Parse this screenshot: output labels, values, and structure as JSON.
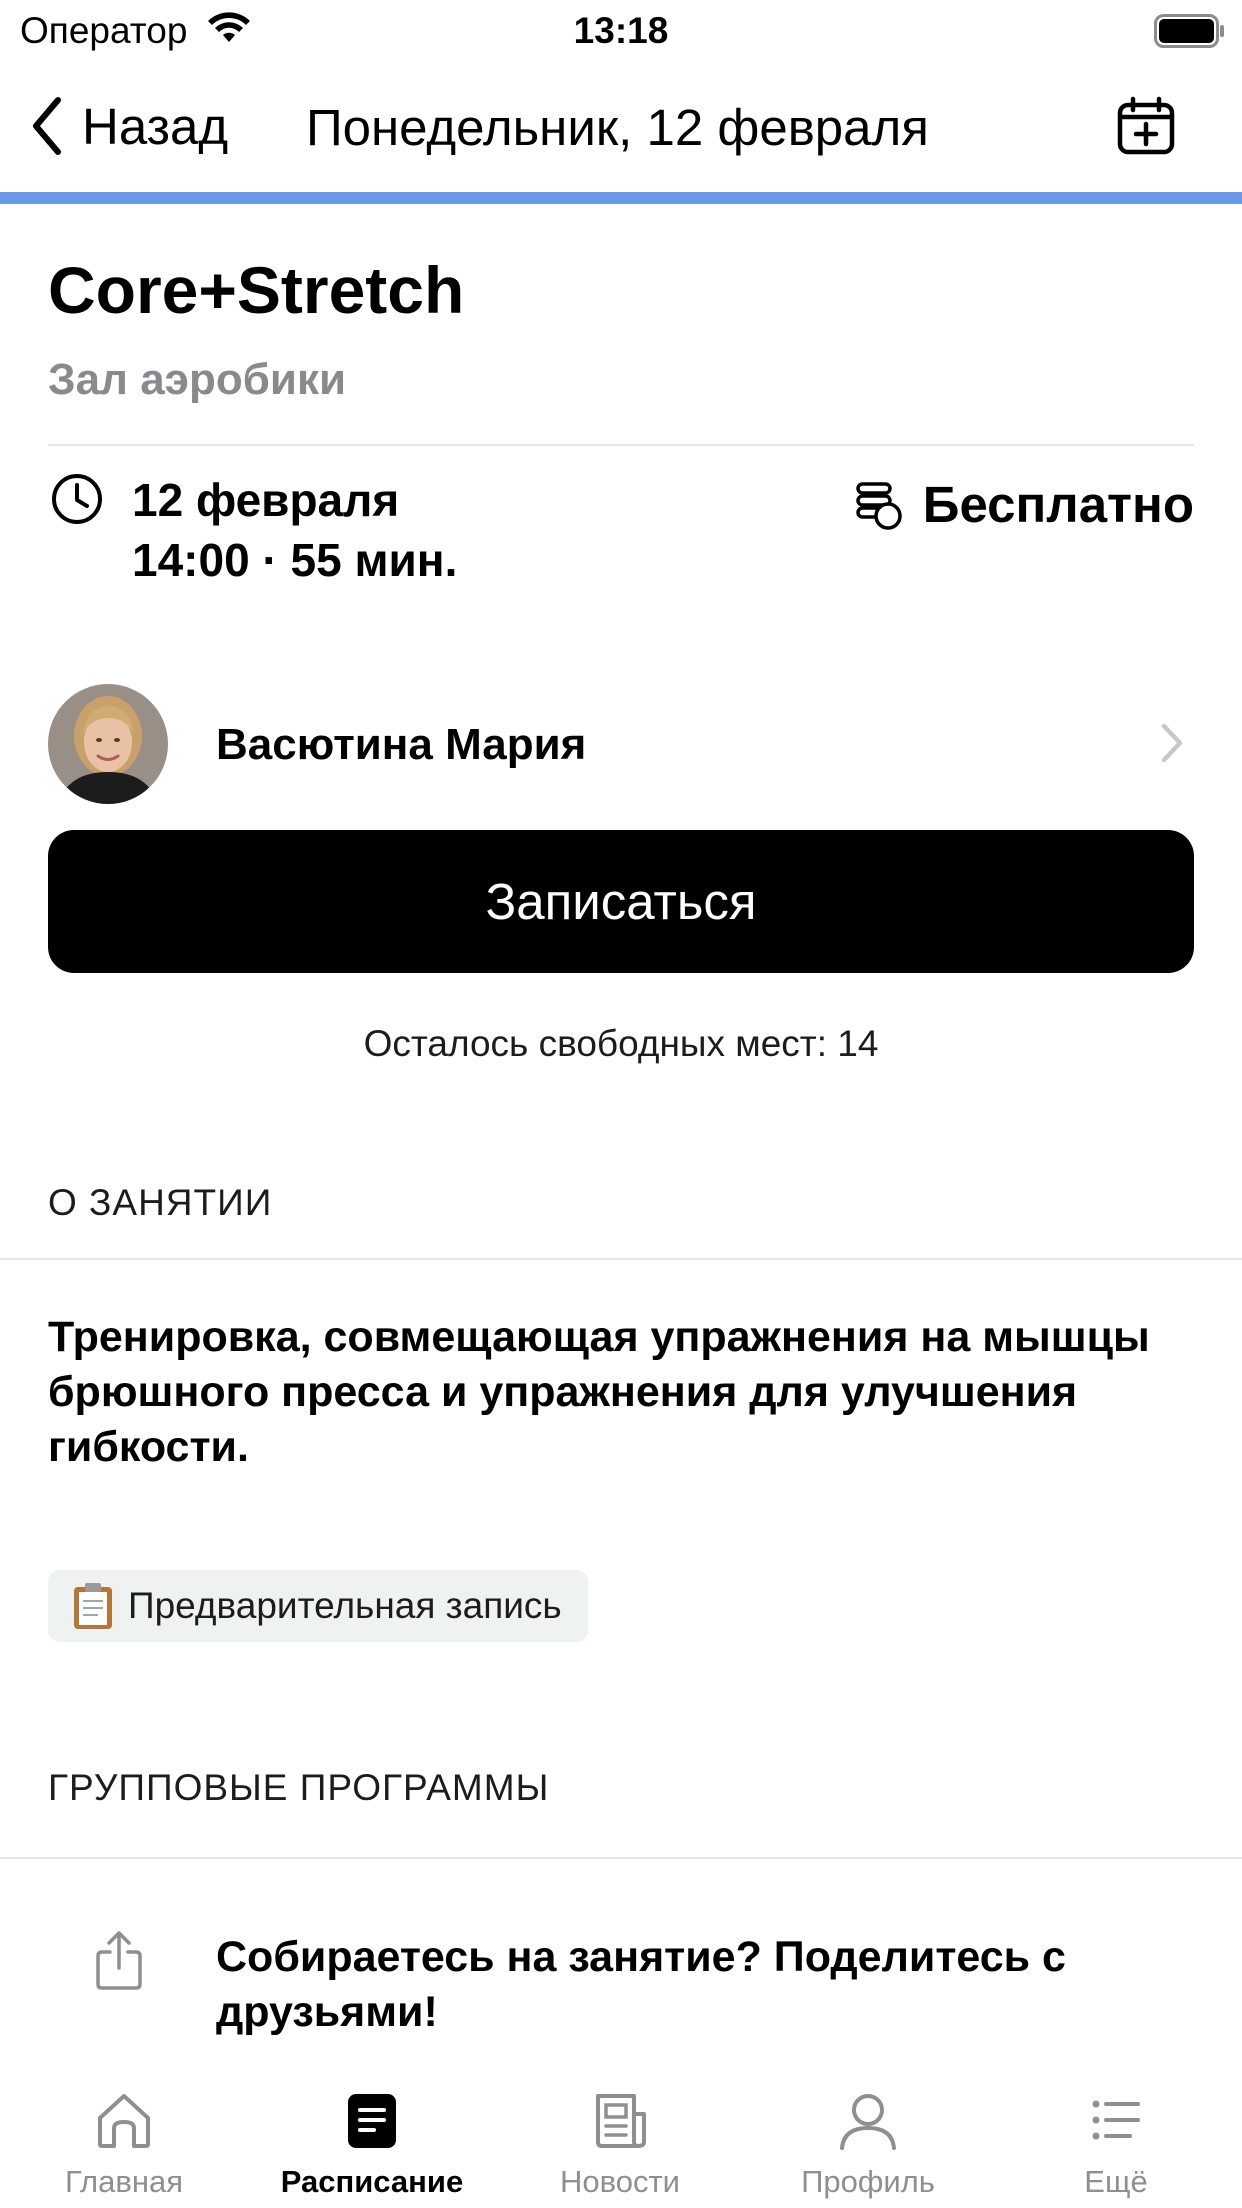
{
  "status_bar": {
    "carrier": "Оператор",
    "time": "13:18"
  },
  "nav": {
    "back_label": "Назад",
    "title": "Понедельник, 12 февраля",
    "calendar_icon": "calendar-plus-icon"
  },
  "colors": {
    "accent": "#6a97e6",
    "primary_button": "#000000",
    "muted_text": "#8a8a8e"
  },
  "class": {
    "title": "Core+Stretch",
    "room": "Зал аэробики",
    "date": "12 февраля",
    "time": "14:00 · 55 мин.",
    "price": "Бесплатно"
  },
  "trainer": {
    "name": "Васютина Мария"
  },
  "signup": {
    "button_label": "Записаться",
    "seats_left": "Осталось свободных мест: 14"
  },
  "about": {
    "section_title": "О ЗАНЯТИИ",
    "description": "Тренировка, совмещающая упражнения на мышцы брюшного пресса и упражнения для улучшения гибкости.",
    "tag": "Предварительная запись"
  },
  "programs": {
    "section_title": "ГРУППОВЫЕ ПРОГРАММЫ"
  },
  "share": {
    "text": "Собираетесь на занятие? Поделитесь с друзьями!"
  },
  "tabbar": {
    "active": "schedule",
    "items": [
      {
        "label": "Главная",
        "icon": "home-icon"
      },
      {
        "label": "Расписание",
        "icon": "schedule-icon"
      },
      {
        "label": "Новости",
        "icon": "news-icon"
      },
      {
        "label": "Профиль",
        "icon": "profile-icon"
      },
      {
        "label": "Ещё",
        "icon": "more-list-icon"
      }
    ]
  }
}
